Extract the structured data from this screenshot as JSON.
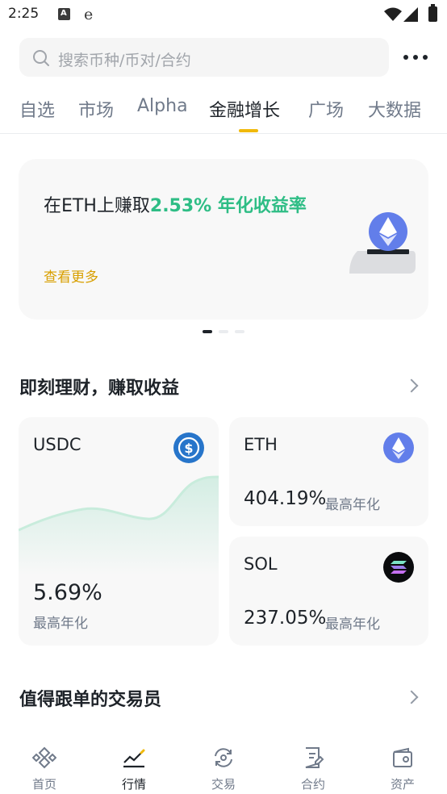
{
  "status_bar": {
    "time": "2:25"
  },
  "search": {
    "placeholder": "搜索币种/币对/合约"
  },
  "tabs": [
    {
      "label": "自选"
    },
    {
      "label": "市场"
    },
    {
      "label": "Alpha"
    },
    {
      "label": "金融增长",
      "active": true
    },
    {
      "label": "广场"
    },
    {
      "label": "大数据"
    }
  ],
  "banner": {
    "text_prefix": "在ETH上赚取",
    "text_highlight": "2.53% 年化收益率",
    "link": "查看更多",
    "active_page": 1,
    "page_count": 3
  },
  "earn_section": {
    "title": "即刻理财，赚取收益",
    "products": [
      {
        "coin": "USDC",
        "rate": "5.69%",
        "rate_label": "最高年化",
        "icon": "usdc-coin-icon"
      },
      {
        "coin": "ETH",
        "rate": "404.19%",
        "rate_label": "最高年化",
        "icon": "eth-coin-icon"
      },
      {
        "coin": "SOL",
        "rate": "237.05%",
        "rate_label": "最高年化",
        "icon": "sol-coin-icon"
      }
    ]
  },
  "traders_section": {
    "title": "值得跟单的交易员"
  },
  "bottom_nav": [
    {
      "label": "首页",
      "icon": "binance-logo-icon"
    },
    {
      "label": "行情",
      "icon": "market-chart-icon",
      "active": true
    },
    {
      "label": "交易",
      "icon": "trade-swap-icon"
    },
    {
      "label": "合约",
      "icon": "futures-doc-icon"
    },
    {
      "label": "资产",
      "icon": "wallet-icon"
    }
  ],
  "colors": {
    "accent": "#f0b90b",
    "positive": "#2ebd85",
    "link": "#d89f00",
    "usdc": "#2775ca",
    "eth": "#627eea"
  }
}
